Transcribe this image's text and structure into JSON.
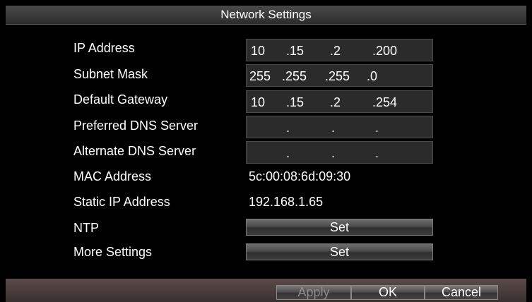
{
  "window": {
    "title": "Network Settings"
  },
  "fields": {
    "ip_address": {
      "label": "IP Address",
      "octets": [
        "10",
        ".15",
        ".2",
        ".200"
      ]
    },
    "subnet_mask": {
      "label": "Subnet Mask",
      "octets": [
        "255",
        ".255",
        ".255",
        ".0"
      ]
    },
    "default_gateway": {
      "label": "Default Gateway",
      "octets": [
        "10",
        ".15",
        ".2",
        ".254"
      ]
    },
    "preferred_dns": {
      "label": "Preferred DNS Server",
      "octets": [
        "",
        ".",
        ".",
        "."
      ]
    },
    "alternate_dns": {
      "label": "Alternate DNS Server",
      "octets": [
        "",
        ".",
        ".",
        "."
      ]
    }
  },
  "info": {
    "mac_label": "MAC Address",
    "mac_value": "5c:00:08:6d:09:30",
    "static_label": "Static IP Address",
    "static_value": "192.168.1.65"
  },
  "ntp": {
    "label": "NTP",
    "button": "Set"
  },
  "more": {
    "label": "More Settings",
    "button": "Set"
  },
  "footer": {
    "apply": "Apply",
    "ok": "OK",
    "cancel": "Cancel"
  }
}
